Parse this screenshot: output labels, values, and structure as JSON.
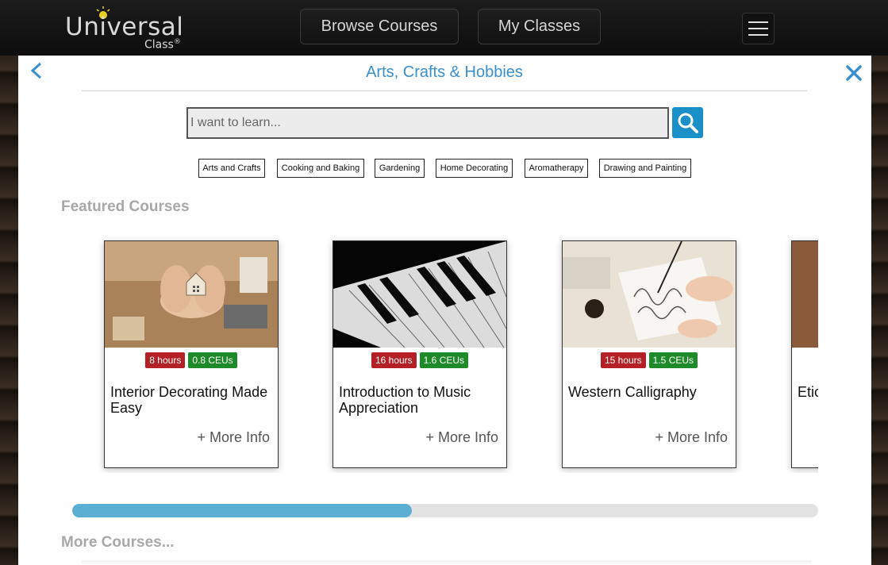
{
  "nav": {
    "logo_main": "Universal",
    "logo_sub": "Class",
    "logo_reg": "®",
    "browse_label": "Browse Courses",
    "classes_label": "My Classes"
  },
  "panel": {
    "title": "Arts, Crafts & Hobbies",
    "back_glyph": "<"
  },
  "search": {
    "placeholder": "I want to learn..."
  },
  "tags": [
    "Arts and Crafts",
    "Cooking and Baking",
    "Gardening",
    "Home Decorating",
    "Aromatherapy",
    "Drawing and Painting"
  ],
  "featured": {
    "title": "Featured Courses",
    "cards": [
      {
        "hours": "8 hours",
        "ceus": "0.8 CEUs",
        "title": "Interior Decorating Made Easy",
        "more": "+ More Info"
      },
      {
        "hours": "16 hours",
        "ceus": "1.6 CEUs",
        "title": "Introduction to Music Appreciation",
        "more": "+ More Info"
      },
      {
        "hours": "15 hours",
        "ceus": "1.5 CEUs",
        "title": "Western Calligraphy",
        "more": "+ More Info"
      },
      {
        "hours": "",
        "ceus": "",
        "title": "Etic",
        "more": ""
      }
    ],
    "scroll_progress_percent": 45.5
  },
  "more": {
    "title": "More Courses..."
  },
  "colors": {
    "accent": "#3a8fcf",
    "search_button": "#1a8fc8",
    "hours_badge": "#b52026",
    "ceu_badge": "#1f8a2a",
    "progress_fill": "#5aafd2"
  }
}
